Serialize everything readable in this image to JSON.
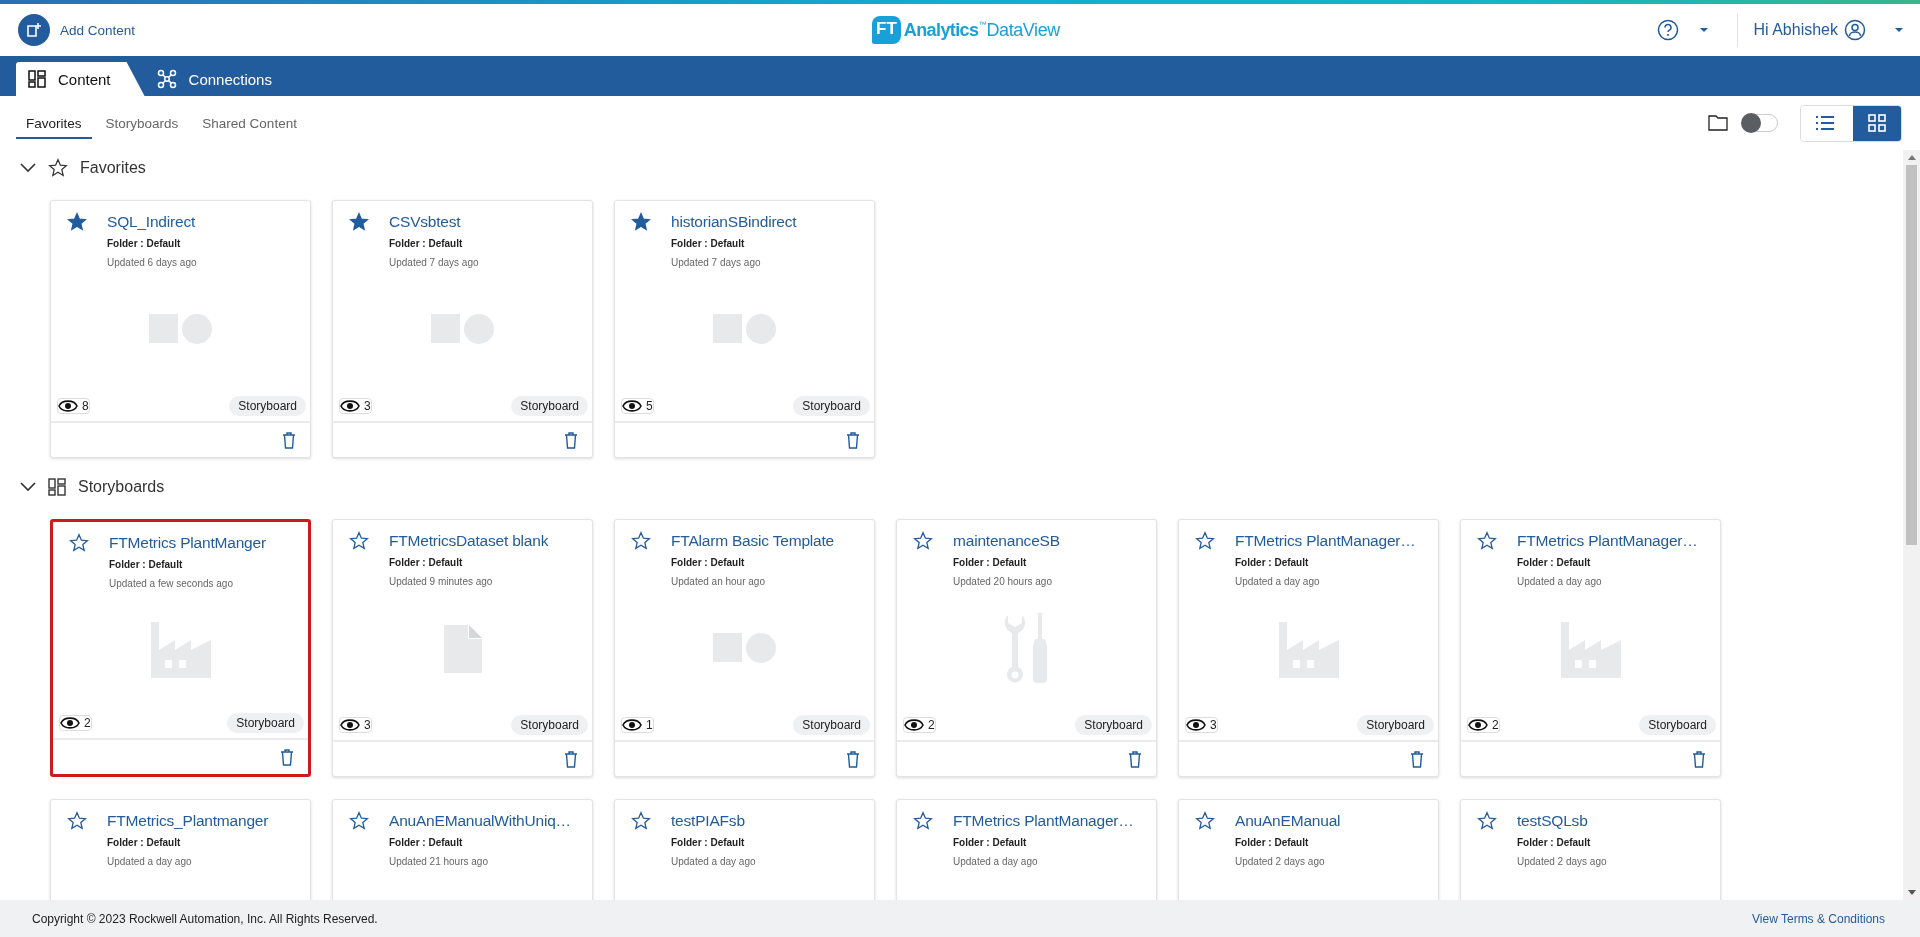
{
  "header": {
    "add_content": "Add Content",
    "logo": {
      "mark": "FT",
      "name": "Analytics",
      "tm": "™",
      "product": "DataView"
    },
    "greeting": "Hi Abhishek"
  },
  "nav_tabs": [
    {
      "label": "Content",
      "selected": true
    },
    {
      "label": "Connections",
      "selected": false
    }
  ],
  "sub_tabs": [
    {
      "label": "Favorites",
      "selected": true
    },
    {
      "label": "Storyboards",
      "selected": false
    },
    {
      "label": "Shared Content",
      "selected": false
    }
  ],
  "toolbar": {
    "folders_toggle": {
      "on": false
    },
    "views": [
      {
        "kind": "list",
        "selected": false
      },
      {
        "kind": "grid",
        "selected": true
      }
    ]
  },
  "sections": [
    {
      "title": "Favorites",
      "expanded": true,
      "cards": [
        {
          "title": "SQL_Indirect",
          "favorite": true,
          "selected": false,
          "folder": "Folder : Default",
          "updated": "Updated 6 days ago",
          "kind": "shapes",
          "views": "8",
          "type": "Storyboard"
        },
        {
          "title": "CSVsbtest",
          "favorite": true,
          "selected": false,
          "folder": "Folder : Default",
          "updated": "Updated 7 days ago",
          "kind": "shapes",
          "views": "3",
          "type": "Storyboard"
        },
        {
          "title": "historianSBindirect",
          "favorite": true,
          "selected": false,
          "folder": "Folder : Default",
          "updated": "Updated 7 days ago",
          "kind": "shapes",
          "views": "5",
          "type": "Storyboard"
        }
      ]
    },
    {
      "title": "Storyboards",
      "expanded": true,
      "cards": [
        {
          "title": "FTMetrics PlantManger",
          "favorite": false,
          "selected": true,
          "folder": "Folder : Default",
          "updated": "Updated a few seconds ago",
          "kind": "factory",
          "views": "2",
          "type": "Storyboard"
        },
        {
          "title": "FTMetricsDataset blank",
          "favorite": false,
          "selected": false,
          "folder": "Folder : Default",
          "updated": "Updated 9 minutes ago",
          "kind": "document",
          "views": "3",
          "type": "Storyboard"
        },
        {
          "title": "FTAlarm Basic Template",
          "favorite": false,
          "selected": false,
          "folder": "Folder : Default",
          "updated": "Updated an hour ago",
          "kind": "shapes",
          "views": "1",
          "type": "Storyboard"
        },
        {
          "title": "maintenanceSB",
          "favorite": false,
          "selected": false,
          "folder": "Folder : Default",
          "updated": "Updated 20 hours ago",
          "kind": "tools",
          "views": "2",
          "type": "Storyboard"
        },
        {
          "title": "FTMetrics PlantManager…",
          "favorite": false,
          "selected": false,
          "folder": "Folder : Default",
          "updated": "Updated a day ago",
          "kind": "factory",
          "views": "3",
          "type": "Storyboard"
        },
        {
          "title": "FTMetrics PlantManager…",
          "favorite": false,
          "selected": false,
          "folder": "Folder : Default",
          "updated": "Updated a day ago",
          "kind": "factory",
          "views": "2",
          "type": "Storyboard"
        },
        {
          "title": "FTMetrics_Plantmanger",
          "favorite": false,
          "selected": false,
          "folder": "Folder : Default",
          "updated": "Updated a day ago"
        },
        {
          "title": "AnuAnEManualWithUniq…",
          "favorite": false,
          "selected": false,
          "folder": "Folder : Default",
          "updated": "Updated 21 hours ago"
        },
        {
          "title": "testPIAFsb",
          "favorite": false,
          "selected": false,
          "folder": "Folder : Default",
          "updated": "Updated a day ago"
        },
        {
          "title": "FTMetrics PlantManager…",
          "favorite": false,
          "selected": false,
          "folder": "Folder : Default",
          "updated": "Updated a day ago"
        },
        {
          "title": "AnuAnEManual",
          "favorite": false,
          "selected": false,
          "folder": "Folder : Default",
          "updated": "Updated 2 days ago"
        },
        {
          "title": "testSQLsb",
          "favorite": false,
          "selected": false,
          "folder": "Folder : Default",
          "updated": "Updated 2 days ago"
        }
      ]
    }
  ],
  "footer": {
    "copyright": "Copyright © 2023 Rockwell Automation, Inc. All Rights Reserved.",
    "terms_link": "View Terms & Conditions"
  }
}
